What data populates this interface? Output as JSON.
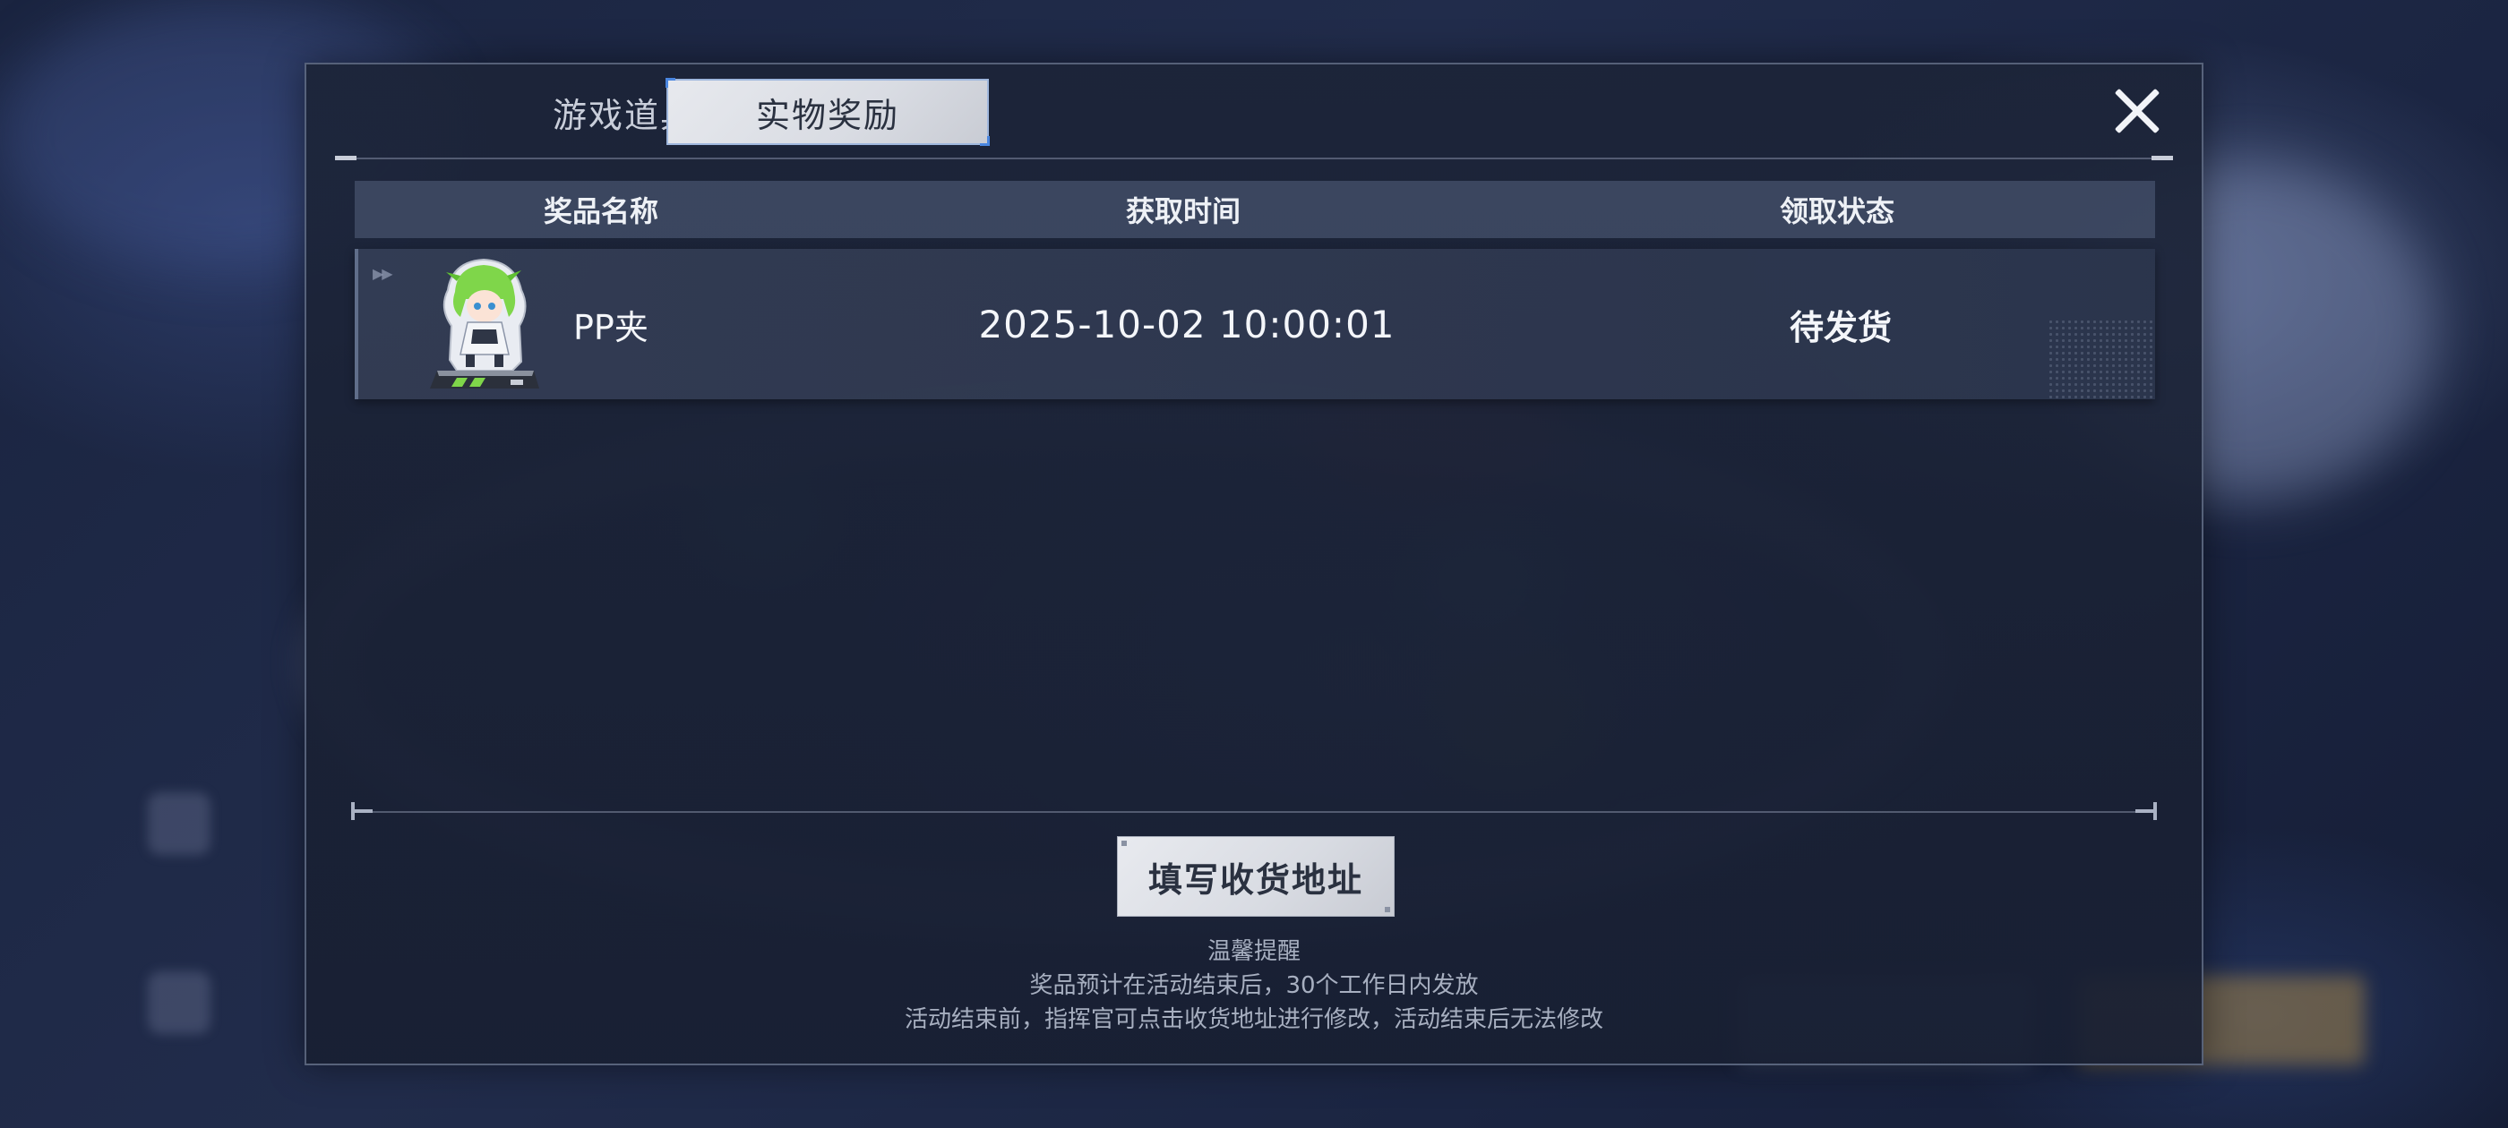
{
  "tabs": {
    "game_items": "游戏道具",
    "physical_rewards": "实物奖励"
  },
  "table": {
    "headers": {
      "name": "奖品名称",
      "time": "获取时间",
      "status": "领取状态"
    },
    "rows": [
      {
        "name": "PP夹",
        "time": "2025-10-02 10:00:01",
        "status": "待发货",
        "icon": "character-acrylic-stand-icon"
      }
    ]
  },
  "address_button": "填写收货地址",
  "notes": {
    "title": "温馨提醒",
    "line1": "奖品预计在活动结束后，30个工作日内发放",
    "line2": "活动结束前，指挥官可点击收货地址进行修改，活动结束后无法修改"
  },
  "colors": {
    "accent_selected_tab_border": "#4a86e0",
    "panel_bg": "#1c2438",
    "button_bg": "#e8eaef"
  }
}
